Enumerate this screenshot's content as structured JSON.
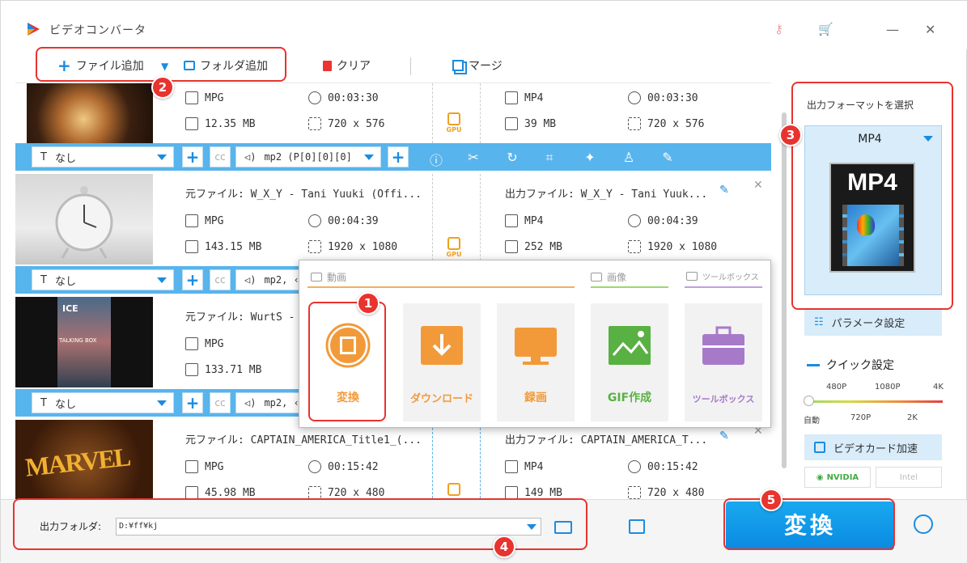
{
  "window": {
    "title": "ビデオコンバータ"
  },
  "toolbar": {
    "add_file": "ファイル追加",
    "add_folder": "フォルダ追加",
    "clear": "クリア",
    "merge": "マージ"
  },
  "items": [
    {
      "src_name": "",
      "src_fmt": "MPG",
      "src_dur": "00:03:30",
      "src_size": "12.35 MB",
      "src_res": "720 x 576",
      "dst_name": "",
      "dst_fmt": "MP4",
      "dst_dur": "00:03:30",
      "dst_size": "39 MB",
      "dst_res": "720 x 576",
      "subtitle": "なし",
      "audio": "mp2 (P[0][0][0]"
    },
    {
      "src_name": "元ファイル: W_X_Y - Tani Yuuki (Offi...",
      "src_fmt": "MPG",
      "src_dur": "00:04:39",
      "src_size": "143.15 MB",
      "src_res": "1920 x 1080",
      "dst_name": "出力ファイル: W_X_Y - Tani Yuuk...",
      "dst_fmt": "MP4",
      "dst_dur": "00:04:39",
      "dst_size": "252 MB",
      "dst_res": "1920 x 1080",
      "subtitle": "なし",
      "audio": "mp2, ‹"
    },
    {
      "src_name": "元ファイル: WurtS -",
      "src_fmt": "MPG",
      "src_size": "133.71 MB",
      "subtitle": "なし",
      "audio": "mp2, ‹"
    },
    {
      "src_name": "元ファイル: CAPTAIN_AMERICA_Title1_(...",
      "src_fmt": "MPG",
      "src_dur": "00:15:42",
      "src_size": "45.98 MB",
      "src_res": "720 x 480",
      "dst_name": "出力ファイル: CAPTAIN_AMERICA_T...",
      "dst_fmt": "MP4",
      "dst_dur": "00:15:42",
      "dst_size": "149 MB",
      "dst_res": "720 x 480"
    }
  ],
  "gpu_label": "GPU",
  "thumb_text": {
    "ice": "ICE",
    "talking": "TALKING BOX",
    "marvel": "MARVEL"
  },
  "popup": {
    "cat_video": "動画",
    "cat_image": "画像",
    "cat_tools": "ツールボックス",
    "tiles": [
      "変換",
      "ダウンロード",
      "録画",
      "GIF作成",
      "ツールボックス"
    ]
  },
  "right": {
    "title": "出力フォーマットを選択",
    "format": "MP4",
    "param": "パラメータ設定",
    "quick": "クイック設定",
    "q_top": [
      "480P",
      "1080P",
      "4K"
    ],
    "q_bottom": [
      "自動",
      "720P",
      "2K"
    ],
    "q_level": 0,
    "vcard": "ビデオカード加速",
    "nvidia": "NVIDIA",
    "intel": "Intel"
  },
  "bottom": {
    "out_label": "出力フォルダ:",
    "out_value": "D:¥ff¥kj",
    "convert": "変換"
  },
  "badges": [
    "1",
    "2",
    "3",
    "4",
    "5"
  ],
  "colors": {
    "accent": "#1a8ce0",
    "annotation": "#e8332e",
    "tile_orange": "#f29a3a",
    "tile_green": "#59b043",
    "tile_purple": "#a77ac9",
    "convert": "#0a9ae8"
  }
}
